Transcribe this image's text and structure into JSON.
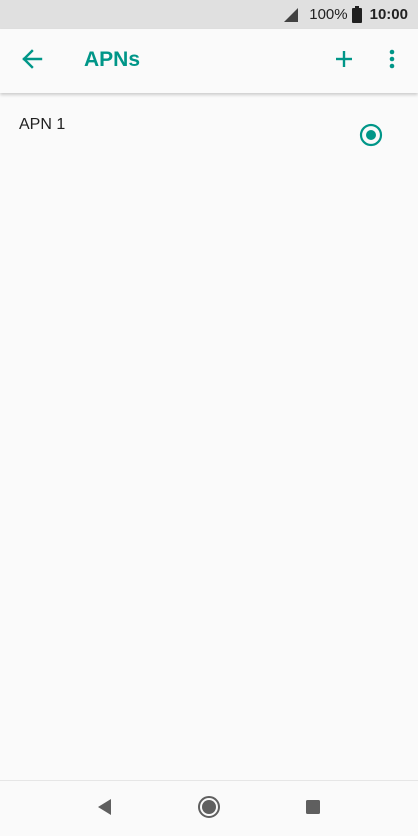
{
  "status_bar": {
    "battery_percent": "100%",
    "time": "10:00",
    "signal_icon": "signal-icon",
    "battery_icon": "battery-icon"
  },
  "app_bar": {
    "title": "APNs",
    "back_icon": "arrow-back-icon",
    "add_icon": "plus-icon",
    "more_icon": "more-vertical-icon"
  },
  "apn_list": {
    "items": [
      {
        "name": "APN 1",
        "selected": true
      }
    ]
  },
  "nav_bar": {
    "back_icon": "nav-back-icon",
    "home_icon": "nav-home-icon",
    "recents_icon": "nav-recents-icon"
  },
  "colors": {
    "accent": "#009688",
    "status_bar_bg": "#e0e0e0",
    "background": "#fafafa",
    "text_primary": "#212121",
    "nav_icon": "#5f5f5f"
  }
}
